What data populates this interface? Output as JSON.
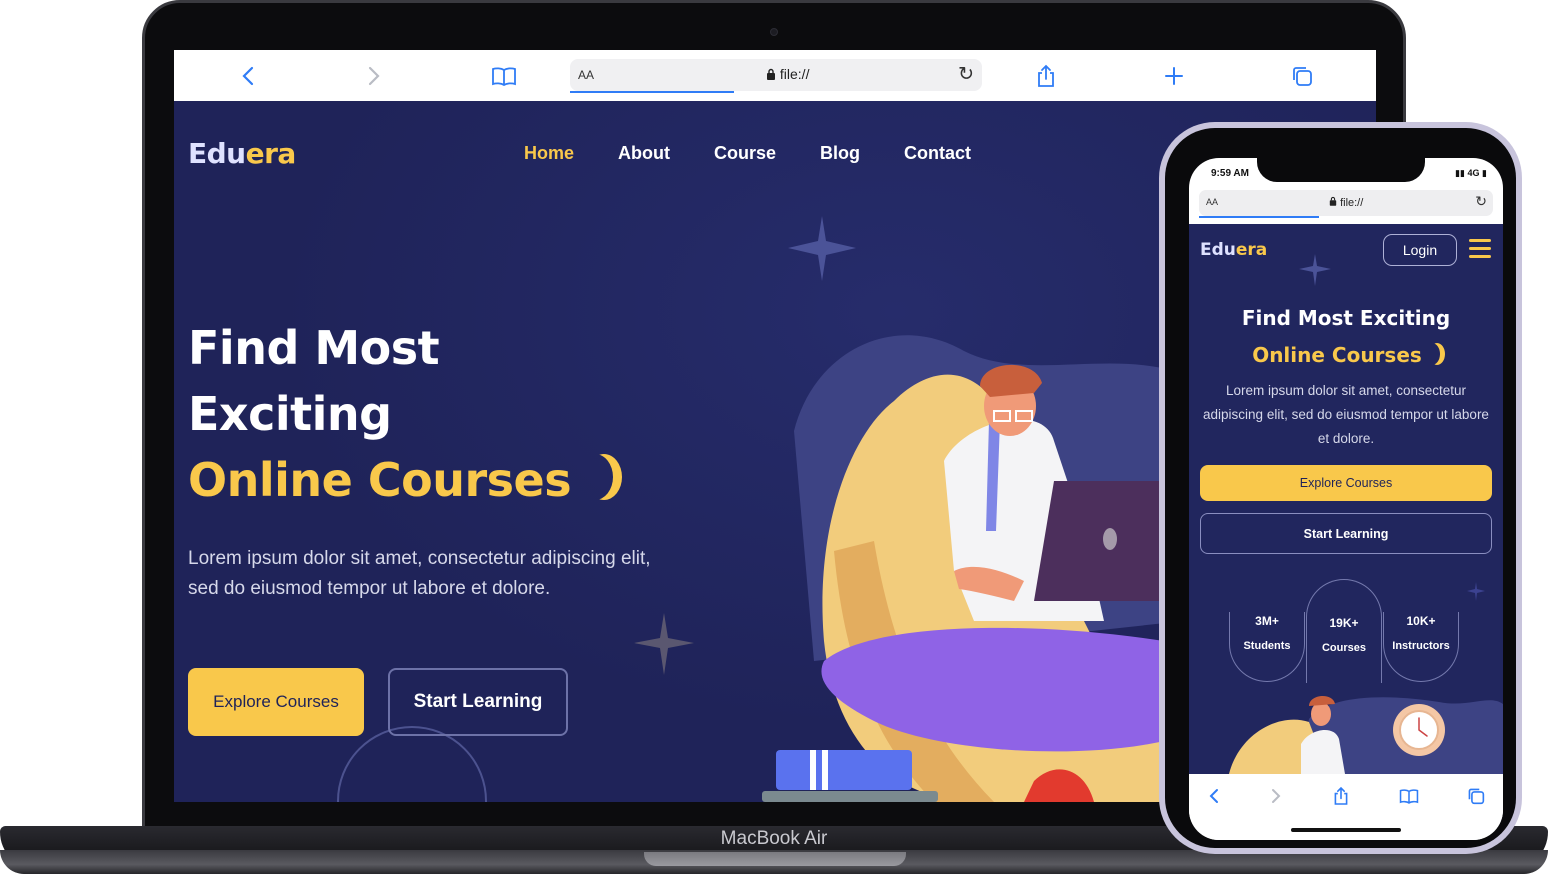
{
  "laptop": {
    "brand": "MacBook Air",
    "browser": {
      "address_aa": "AA",
      "url": "file://",
      "icons": [
        "back-icon",
        "forward-icon",
        "bookmarks-icon",
        "reload-icon",
        "share-icon",
        "new-tab-icon",
        "tabs-icon"
      ]
    },
    "site": {
      "logo_main": "Edu",
      "logo_accent": "era",
      "nav": [
        "Home",
        "About",
        "Course",
        "Blog",
        "Contact"
      ],
      "hero": {
        "line1": "Find Most",
        "line2": "Exciting",
        "highlight": "Online Courses",
        "description": "Lorem ipsum dolor sit amet, consectetur adipiscing elit, sed do eiusmod tempor ut labore et dolore.",
        "primary_button": "Explore Courses",
        "secondary_button": "Start Learning"
      }
    }
  },
  "phone": {
    "status": {
      "time": "9:59 AM",
      "signal": "4G"
    },
    "browser": {
      "address_aa": "AA",
      "url": "file://"
    },
    "site": {
      "logo_main": "Edu",
      "logo_accent": "era",
      "login_button": "Login",
      "title": "Find Most Exciting",
      "highlight": "Online Courses",
      "description": "Lorem ipsum dolor sit amet, consectetur adipiscing elit, sed do eiusmod tempor ut labore et dolore.",
      "primary_button": "Explore Courses",
      "secondary_button": "Start Learning",
      "stats": [
        {
          "value": "3M+",
          "label": "Students"
        },
        {
          "value": "19K+",
          "label": "Courses"
        },
        {
          "value": "10K+",
          "label": "Instructors"
        }
      ]
    }
  },
  "colors": {
    "background": "#1f2359",
    "accent": "#f9c84b",
    "browser_link": "#2f7cf6",
    "illustration_purple": "#8f63e6"
  }
}
